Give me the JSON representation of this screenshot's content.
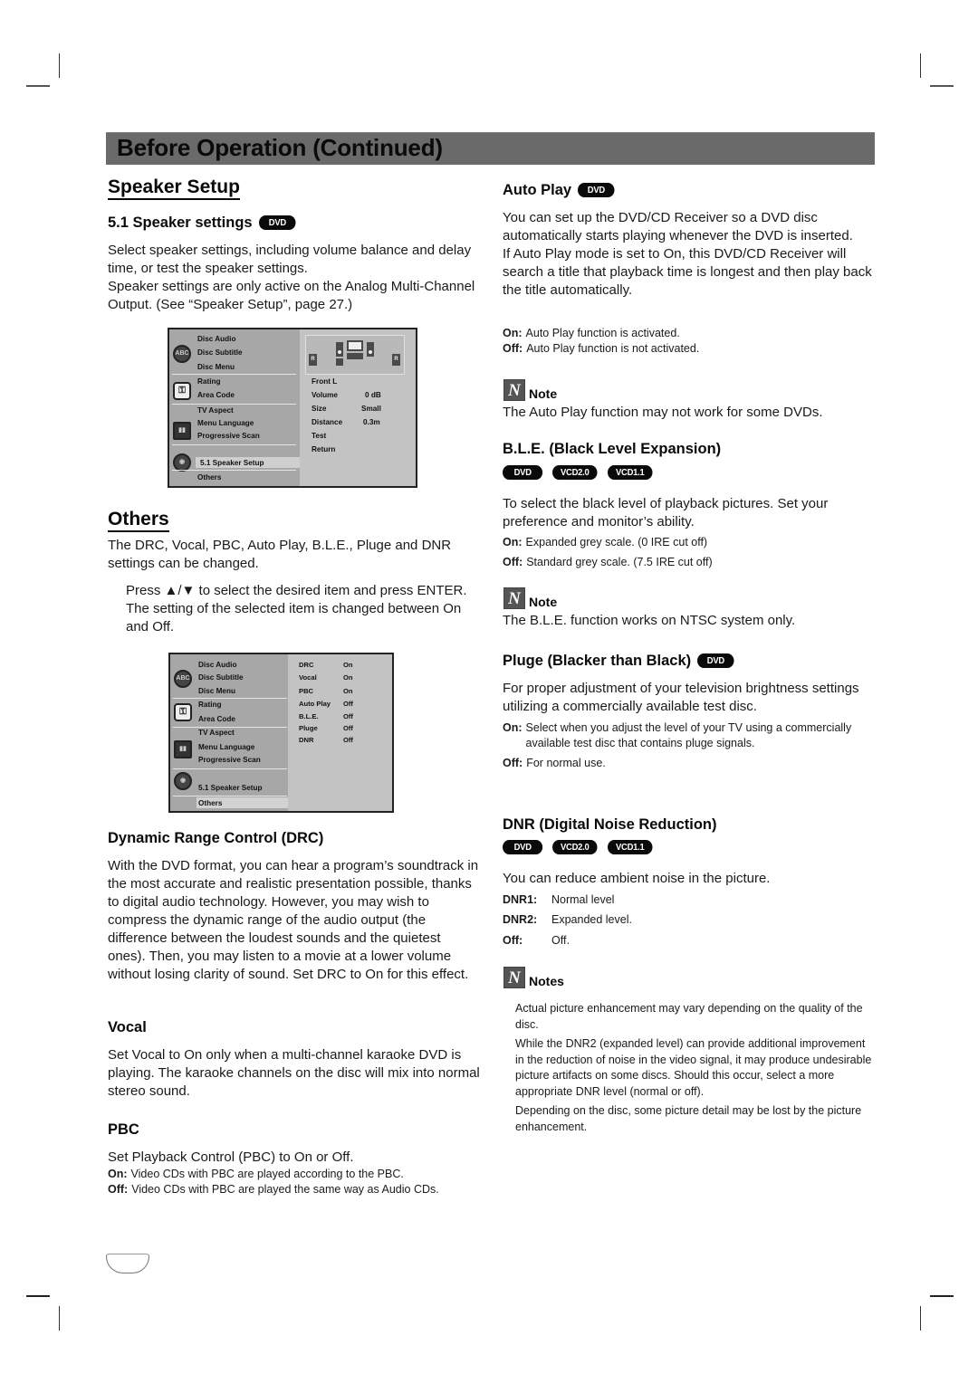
{
  "header": {
    "title": "Before Operation (Continued)"
  },
  "speaker_setup": {
    "heading": "Speaker Setup",
    "sub_heading": "5.1 Speaker settings",
    "badge": "DVD",
    "paragraphs": [
      "Select speaker settings, including volume balance and delay time, or test the speaker settings.",
      "Speaker settings are only active on the Analog Multi-Channel Output. (See “Speaker Setup”, page 27.)"
    ],
    "osd": {
      "menu_items": [
        "Disc Audio",
        "Disc Subtitle",
        "Disc Menu",
        "Rating",
        "Area Code",
        "TV Aspect",
        "Menu Language",
        "Progressive Scan",
        "5.1 Speaker Setup",
        "Others"
      ],
      "selected_item": "5.1 Speaker Setup",
      "speaker_label_left": "R",
      "speaker_label_right": "R",
      "settings": [
        {
          "label": "Front L",
          "value": ""
        },
        {
          "label": "Volume",
          "value": "0 dB"
        },
        {
          "label": "Size",
          "value": "Small"
        },
        {
          "label": "Distance",
          "value": "0.3m"
        },
        {
          "label": "Test",
          "value": ""
        },
        {
          "label": "Return",
          "value": ""
        }
      ]
    }
  },
  "others": {
    "heading": "Others",
    "intro": "The DRC, Vocal, PBC, Auto Play, B.L.E., Pluge and DNR settings can be changed.",
    "instruction": "Press ▲/▼ to select the desired item and press ENTER. The setting of the selected item is changed between On and Off.",
    "osd": {
      "menu_items": [
        "Disc Audio",
        "Disc Subtitle",
        "Disc Menu",
        "Rating",
        "Area Code",
        "TV Aspect",
        "Menu Language",
        "Progressive Scan",
        "5.1 Speaker Setup",
        "Others"
      ],
      "selected_item": "Others",
      "settings": [
        {
          "label": "DRC",
          "value": "On"
        },
        {
          "label": "Vocal",
          "value": "On"
        },
        {
          "label": "PBC",
          "value": "On"
        },
        {
          "label": "Auto Play",
          "value": "Off"
        },
        {
          "label": "B.L.E.",
          "value": "Off"
        },
        {
          "label": "Pluge",
          "value": "Off"
        },
        {
          "label": "DNR",
          "value": "Off"
        }
      ]
    }
  },
  "drc": {
    "heading": "Dynamic Range Control (DRC)",
    "body": "With the DVD format, you can hear a program’s soundtrack in the most accurate and realistic presentation possible, thanks to digital audio technology. However, you may wish to compress the dynamic range of the audio output (the difference between the loudest sounds and the quietest ones). Then, you may listen to a movie at a lower volume without losing clarity of sound. Set DRC to On for this effect."
  },
  "vocal": {
    "heading": "Vocal",
    "body": "Set Vocal to On only when a multi-channel karaoke DVD is playing. The karaoke channels on the disc will mix into normal stereo sound."
  },
  "pbc": {
    "heading": "PBC",
    "body": "Set Playback Control (PBC) to On or Off.",
    "options": [
      {
        "key": "On:",
        "text": "Video CDs with PBC are played according to the PBC."
      },
      {
        "key": "Off:",
        "text": "Video CDs with PBC are played the same way as Audio CDs."
      }
    ]
  },
  "auto_play": {
    "heading": "Auto Play",
    "badge": "DVD",
    "paragraphs": [
      "You can set up the DVD/CD Receiver so a DVD disc automatically starts playing whenever the DVD is inserted.",
      "If Auto Play mode is set to On, this DVD/CD Receiver will search a title that playback time is longest and then play back the title automatically."
    ],
    "options": [
      {
        "key": "On:",
        "text": "Auto Play function is activated."
      },
      {
        "key": "Off:",
        "text": "Auto Play function is not activated."
      }
    ],
    "note_label": "Note",
    "note_icon": "N",
    "note_text": "The Auto Play function may not work for some DVDs."
  },
  "ble": {
    "heading": "B.L.E. (Black Level Expansion)",
    "badges": [
      "DVD",
      "VCD2.0",
      "VCD1.1"
    ],
    "body": "To select the black level of playback pictures. Set your preference and monitor’s ability.",
    "options": [
      {
        "key": "On:",
        "text": "Expanded grey scale. (0 IRE cut off)"
      },
      {
        "key": "Off:",
        "text": "Standard grey scale. (7.5 IRE cut off)"
      }
    ],
    "note_label": "Note",
    "note_icon": "N",
    "note_text": "The B.L.E. function works on NTSC system only."
  },
  "pluge": {
    "heading": "Pluge (Blacker than Black)",
    "badge": "DVD",
    "body": "For proper adjustment of your television brightness settings utilizing a commercially available test disc.",
    "options": [
      {
        "key": "On:",
        "text": "Select when you adjust the level of your TV using a commercially available test disc that contains pluge signals."
      },
      {
        "key": "Off:",
        "text": "For normal use."
      }
    ]
  },
  "dnr": {
    "heading": "DNR (Digital Noise Reduction)",
    "badges": [
      "DVD",
      "VCD2.0",
      "VCD1.1"
    ],
    "body": "You can reduce ambient noise in the picture.",
    "options": [
      {
        "key": "DNR1:",
        "text": "Normal level"
      },
      {
        "key": "DNR2:",
        "text": "Expanded level."
      },
      {
        "key": "Off:",
        "text": "Off."
      }
    ],
    "notes_label": "Notes",
    "note_icon": "N",
    "notes": [
      "Actual picture enhancement may vary depending on the quality of the disc.",
      "While the DNR2 (expanded level) can provide additional improvement in the reduction of noise in the video signal, it may produce undesirable picture artifacts on some discs. Should this occur, select a more appropriate DNR level (normal or off).",
      "Depending on the disc, some picture detail may be lost by the picture enhancement."
    ]
  }
}
